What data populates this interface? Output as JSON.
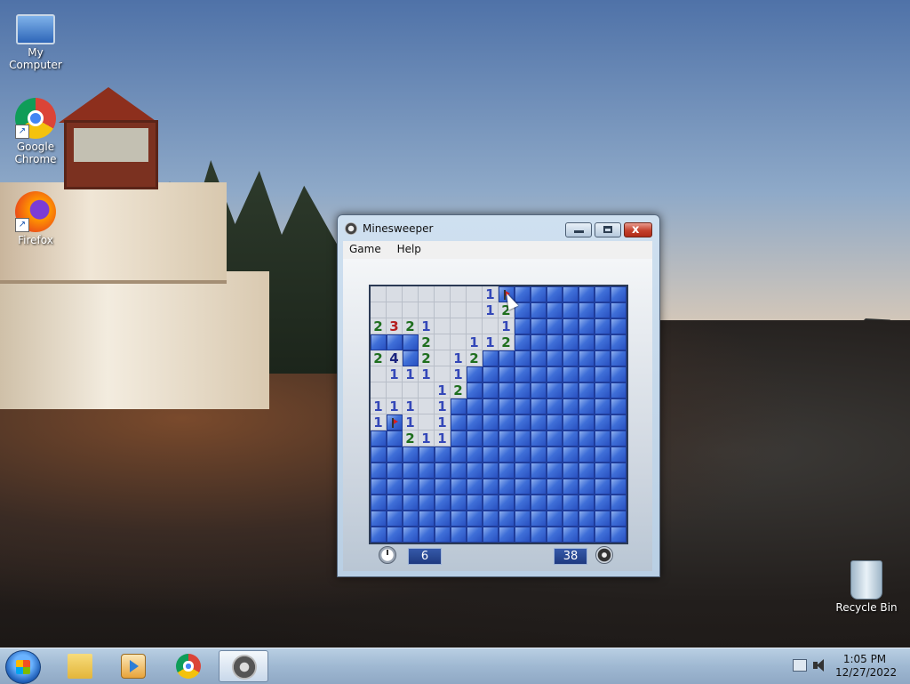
{
  "desktop": {
    "icons": [
      {
        "label": "My Computer",
        "icon": "computer-icon"
      },
      {
        "label": "Google Chrome",
        "icon": "chrome-icon"
      },
      {
        "label": "Firefox",
        "icon": "firefox-icon"
      },
      {
        "label": "Recycle Bin",
        "icon": "recycle-bin-icon"
      }
    ]
  },
  "window": {
    "title": "Minesweeper",
    "menu": [
      "Game",
      "Help"
    ],
    "close_glyph": "x",
    "time": "6",
    "mines_left": "38"
  },
  "board": {
    "rows": [
      [
        "0",
        "0",
        "0",
        "0",
        "0",
        "0",
        "0",
        "1",
        "F",
        "H",
        "H",
        "H",
        "H",
        "H",
        "H",
        "H"
      ],
      [
        "0",
        "0",
        "0",
        "0",
        "0",
        "0",
        "0",
        "1",
        "2",
        "H",
        "H",
        "H",
        "H",
        "H",
        "H",
        "H"
      ],
      [
        "2",
        "3",
        "2",
        "1",
        "0",
        "0",
        "0",
        "0",
        "1",
        "H",
        "H",
        "H",
        "H",
        "H",
        "H",
        "H"
      ],
      [
        "H",
        "H",
        "H",
        "2",
        "0",
        "0",
        "1",
        "1",
        "2",
        "H",
        "H",
        "H",
        "H",
        "H",
        "H",
        "H"
      ],
      [
        "2",
        "4",
        "H",
        "2",
        "0",
        "1",
        "2",
        "H",
        "H",
        "H",
        "H",
        "H",
        "H",
        "H",
        "H",
        "H"
      ],
      [
        "0",
        "1",
        "1",
        "1",
        "0",
        "1",
        "H",
        "H",
        "H",
        "H",
        "H",
        "H",
        "H",
        "H",
        "H",
        "H"
      ],
      [
        "0",
        "0",
        "0",
        "0",
        "1",
        "2",
        "H",
        "H",
        "H",
        "H",
        "H",
        "H",
        "H",
        "H",
        "H",
        "H"
      ],
      [
        "1",
        "1",
        "1",
        "0",
        "1",
        "H",
        "H",
        "H",
        "H",
        "H",
        "H",
        "H",
        "H",
        "H",
        "H",
        "H"
      ],
      [
        "1",
        "F",
        "1",
        "0",
        "1",
        "H",
        "H",
        "H",
        "H",
        "H",
        "H",
        "H",
        "H",
        "H",
        "H",
        "H"
      ],
      [
        "H",
        "H",
        "2",
        "1",
        "1",
        "H",
        "H",
        "H",
        "H",
        "H",
        "H",
        "H",
        "H",
        "H",
        "H",
        "H"
      ],
      [
        "H",
        "H",
        "H",
        "H",
        "H",
        "H",
        "H",
        "H",
        "H",
        "H",
        "H",
        "H",
        "H",
        "H",
        "H",
        "H"
      ],
      [
        "H",
        "H",
        "H",
        "H",
        "H",
        "H",
        "H",
        "H",
        "H",
        "H",
        "H",
        "H",
        "H",
        "H",
        "H",
        "H"
      ],
      [
        "H",
        "H",
        "H",
        "H",
        "H",
        "H",
        "H",
        "H",
        "H",
        "H",
        "H",
        "H",
        "H",
        "H",
        "H",
        "H"
      ],
      [
        "H",
        "H",
        "H",
        "H",
        "H",
        "H",
        "H",
        "H",
        "H",
        "H",
        "H",
        "H",
        "H",
        "H",
        "H",
        "H"
      ],
      [
        "H",
        "H",
        "H",
        "H",
        "H",
        "H",
        "H",
        "H",
        "H",
        "H",
        "H",
        "H",
        "H",
        "H",
        "H",
        "H"
      ],
      [
        "H",
        "H",
        "H",
        "H",
        "H",
        "H",
        "H",
        "H",
        "H",
        "H",
        "H",
        "H",
        "H",
        "H",
        "H",
        "H"
      ]
    ]
  },
  "taskbar": {
    "apps": [
      "start-orb",
      "file-explorer-icon",
      "media-player-icon",
      "chrome-icon",
      "minesweeper-icon"
    ],
    "time": "1:05 PM",
    "date": "12/27/2022"
  }
}
